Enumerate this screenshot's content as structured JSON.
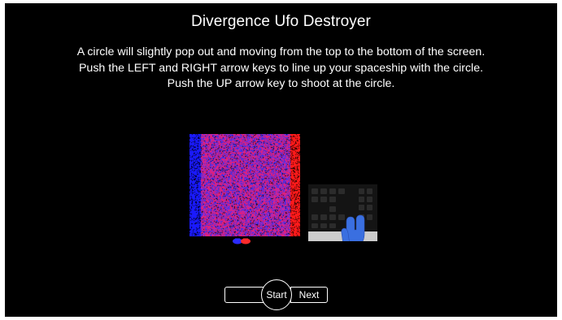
{
  "page": {
    "title": "Divergence Ufo Destroyer",
    "instructions": [
      "A circle will slightly pop out and moving from the top to the bottom of the screen.",
      "Push the LEFT and RIGHT arrow keys to line up your spaceship with the circle.",
      "Push the UP arrow key to shoot at the circle."
    ]
  },
  "stimulus": {
    "colors": {
      "left_edge": "#1a1aff",
      "right_edge": "#ff1a1a",
      "field_red": "#e0207a",
      "field_blue": "#3a2ee8",
      "field_purple": "#9a2bd8"
    }
  },
  "spaceship": {
    "colors": [
      "#2b2bff",
      "#ff2b2b"
    ]
  },
  "keyboard_image": {
    "icon": "keyboard-arrow-keys-hand-icon",
    "hand_color": "#3a6fe0",
    "key_color": "#2b2b2b",
    "base_color": "#cccccc"
  },
  "controls": {
    "back_label": "",
    "start_label": "Start",
    "next_label": "Next"
  },
  "colors": {
    "background": "#000000",
    "text": "#ffffff",
    "page_margin": "#ffffff"
  }
}
